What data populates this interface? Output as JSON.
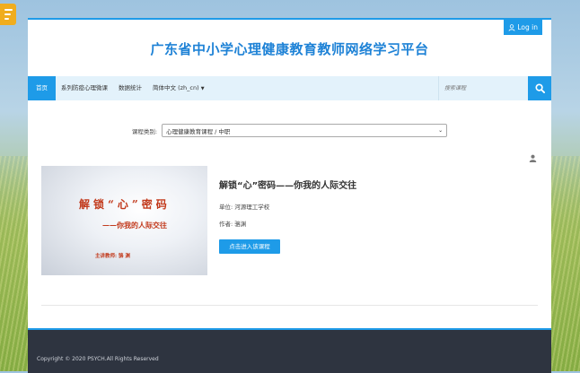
{
  "header": {
    "login_label": "Log in",
    "site_title": "广东省中小学心理健康教育教师网络学习平台"
  },
  "nav": {
    "items": [
      {
        "label": "首页",
        "active": true
      },
      {
        "label": "系列防疫心理微课",
        "active": false
      },
      {
        "label": "数据统计",
        "active": false
      },
      {
        "label": "简体中文 (zh_cn)",
        "active": false
      }
    ],
    "search_placeholder": "搜索课程"
  },
  "filter": {
    "category_label": "课程类别:",
    "category_value": "心理健康教育课程 / 中职"
  },
  "course": {
    "title": "解锁“心”密码——你我的人际交往",
    "unit": "单位: 河源理工学校",
    "author": "作者: 骆渊",
    "enter_label": "点击进入该课程",
    "thumbnail": {
      "line1": "解锁“心”密码",
      "line2": "——你我的人际交往",
      "line3": "主讲教师: 骆 渊"
    }
  },
  "footer": {
    "copyright": "Copyright © 2020 PSYCH.All Rights Reserved"
  },
  "colors": {
    "accent": "#1e9be8",
    "title": "#1e82d6",
    "nav_bg": "#e3f2fb",
    "footer_bg": "#2e3440",
    "menu_tab": "#f0ad1e"
  },
  "icons": [
    "menu-icon",
    "user-icon",
    "search-icon",
    "profile-icon",
    "caret-down-icon"
  ]
}
